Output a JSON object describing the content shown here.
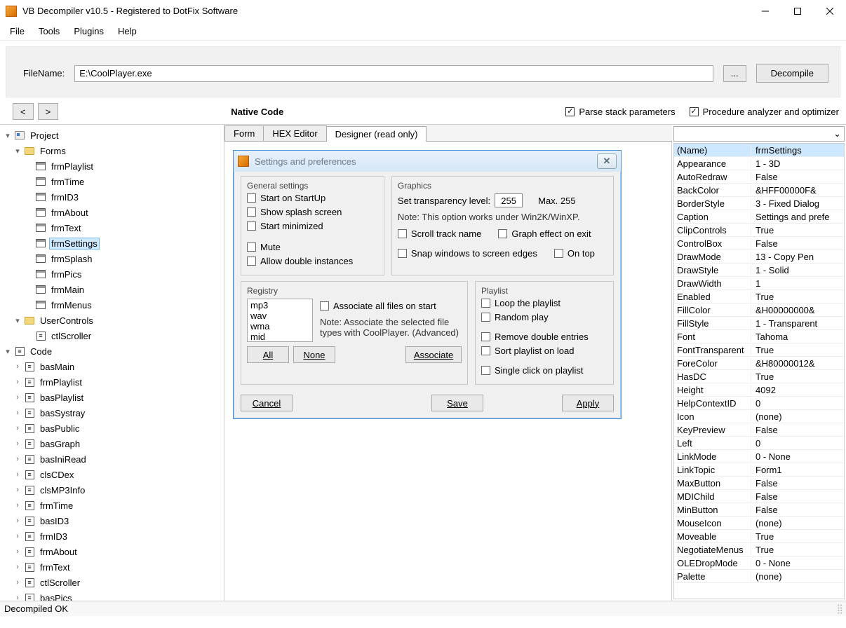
{
  "window": {
    "title": "VB Decompiler v10.5 - Registered to DotFix Software"
  },
  "menu": {
    "file": "File",
    "tools": "Tools",
    "plugins": "Plugins",
    "help": "Help"
  },
  "toolbar": {
    "filename_label": "FileName:",
    "filename_value": "E:\\CoolPlayer.exe",
    "browse": "...",
    "decompile": "Decompile"
  },
  "nav": {
    "back": "<",
    "forward": ">",
    "code_type": "Native Code",
    "parse_stack": "Parse stack parameters",
    "proc_analyzer": "Procedure analyzer and optimizer"
  },
  "tree": {
    "project": "Project",
    "forms": "Forms",
    "forms_items": [
      "frmPlaylist",
      "frmTime",
      "frmID3",
      "frmAbout",
      "frmText",
      "frmSettings",
      "frmSplash",
      "frmPics",
      "frmMain",
      "frmMenus"
    ],
    "usercontrols": "UserControls",
    "usercontrols_items": [
      "ctlScroller"
    ],
    "code": "Code",
    "code_items": [
      "basMain",
      "frmPlaylist",
      "basPlaylist",
      "basSystray",
      "basPublic",
      "basGraph",
      "basIniRead",
      "clsCDex",
      "clsMP3Info",
      "frmTime",
      "basID3",
      "frmID3",
      "frmAbout",
      "frmText",
      "ctlScroller",
      "basPics"
    ]
  },
  "tabs": {
    "form": "Form",
    "hex": "HEX Editor",
    "designer": "Designer (read only)"
  },
  "dialog": {
    "title": "Settings and preferences",
    "general": {
      "label": "General settings",
      "startup": "Start on StartUp",
      "splash": "Show splash screen",
      "minimized": "Start minimized",
      "mute": "Mute",
      "double": "Allow double instances"
    },
    "graphics": {
      "label": "Graphics",
      "transp": "Set transparency level:",
      "transp_val": "255",
      "max": "Max. 255",
      "note": "Note: This option works under Win2K/WinXP.",
      "scroll": "Scroll track name",
      "grapheffect": "Graph effect on exit",
      "snap": "Snap windows to screen edges",
      "ontop": "On top"
    },
    "registry": {
      "label": "Registry",
      "items": [
        "mp3",
        "wav",
        "wma",
        "mid"
      ],
      "assoc_all": "Associate all files on start",
      "note": "Note: Associate the selected file types with CoolPlayer. (Advanced)",
      "all": "All",
      "none": "None",
      "associate": "Associate"
    },
    "playlist": {
      "label": "Playlist",
      "loop": "Loop the playlist",
      "random": "Random play",
      "remove": "Remove double entries",
      "sort": "Sort playlist on load",
      "single": "Single click on playlist"
    },
    "cancel": "Cancel",
    "save": "Save",
    "apply": "Apply"
  },
  "properties": [
    {
      "n": "(Name)",
      "v": "frmSettings",
      "sel": true
    },
    {
      "n": "Appearance",
      "v": "1 - 3D"
    },
    {
      "n": "AutoRedraw",
      "v": "False"
    },
    {
      "n": "BackColor",
      "v": "&HFF00000F&"
    },
    {
      "n": "BorderStyle",
      "v": "3 - Fixed Dialog"
    },
    {
      "n": "Caption",
      "v": "Settings and prefe"
    },
    {
      "n": "ClipControls",
      "v": "True"
    },
    {
      "n": "ControlBox",
      "v": "False"
    },
    {
      "n": "DrawMode",
      "v": "13 - Copy Pen"
    },
    {
      "n": "DrawStyle",
      "v": "1 - Solid"
    },
    {
      "n": "DrawWidth",
      "v": "1"
    },
    {
      "n": "Enabled",
      "v": "True"
    },
    {
      "n": "FillColor",
      "v": "&H00000000&"
    },
    {
      "n": "FillStyle",
      "v": "1 - Transparent"
    },
    {
      "n": "Font",
      "v": "Tahoma"
    },
    {
      "n": "FontTransparent",
      "v": "True"
    },
    {
      "n": "ForeColor",
      "v": "&H80000012&"
    },
    {
      "n": "HasDC",
      "v": "True"
    },
    {
      "n": "Height",
      "v": "4092"
    },
    {
      "n": "HelpContextID",
      "v": "0"
    },
    {
      "n": "Icon",
      "v": "(none)"
    },
    {
      "n": "KeyPreview",
      "v": "False"
    },
    {
      "n": "Left",
      "v": "0"
    },
    {
      "n": "LinkMode",
      "v": "0 - None"
    },
    {
      "n": "LinkTopic",
      "v": "Form1"
    },
    {
      "n": "MaxButton",
      "v": "False"
    },
    {
      "n": "MDIChild",
      "v": "False"
    },
    {
      "n": "MinButton",
      "v": "False"
    },
    {
      "n": "MouseIcon",
      "v": "(none)"
    },
    {
      "n": "Moveable",
      "v": "True"
    },
    {
      "n": "NegotiateMenus",
      "v": "True"
    },
    {
      "n": "OLEDropMode",
      "v": "0 - None"
    },
    {
      "n": "Palette",
      "v": "(none)"
    }
  ],
  "status": {
    "text": "Decompiled OK"
  }
}
